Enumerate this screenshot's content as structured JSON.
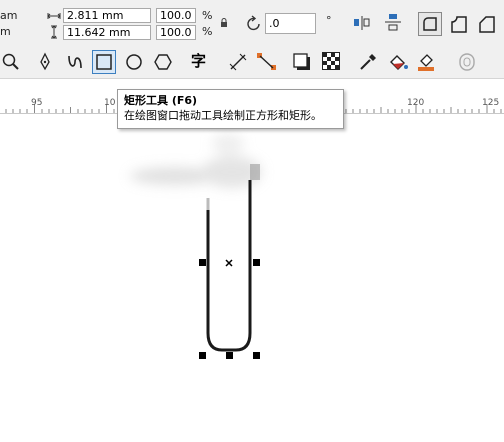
{
  "property_bar": {
    "left_unit_top": "am",
    "left_unit_bottom": "m",
    "width_value": "2.811 mm",
    "height_value": "11.642 mm",
    "scale_x": "100.0",
    "scale_y": "100.0",
    "percent_symbol_top": "%",
    "percent_symbol_bottom": "%",
    "rotation_value": ".0",
    "degree_symbol": "°"
  },
  "toolbox": {
    "text_tool_glyph": "字",
    "active_tool": "rectangle-tool"
  },
  "ruler": {
    "labels": [
      "95",
      "10",
      "120",
      "125"
    ]
  },
  "tooltip": {
    "title": "矩形工具 (F6)",
    "description": "在绘图窗口拖动工具绘制正方形和矩形。"
  },
  "colors": {
    "chrome_bg": "#f0f0f0",
    "active_tool_border": "#3c7fc0",
    "active_tool_bg": "#d9e8f7",
    "ruler_line": "#c8c8c8",
    "accent_orange": "#e0702a",
    "accent_blue": "#2d6fb8"
  }
}
